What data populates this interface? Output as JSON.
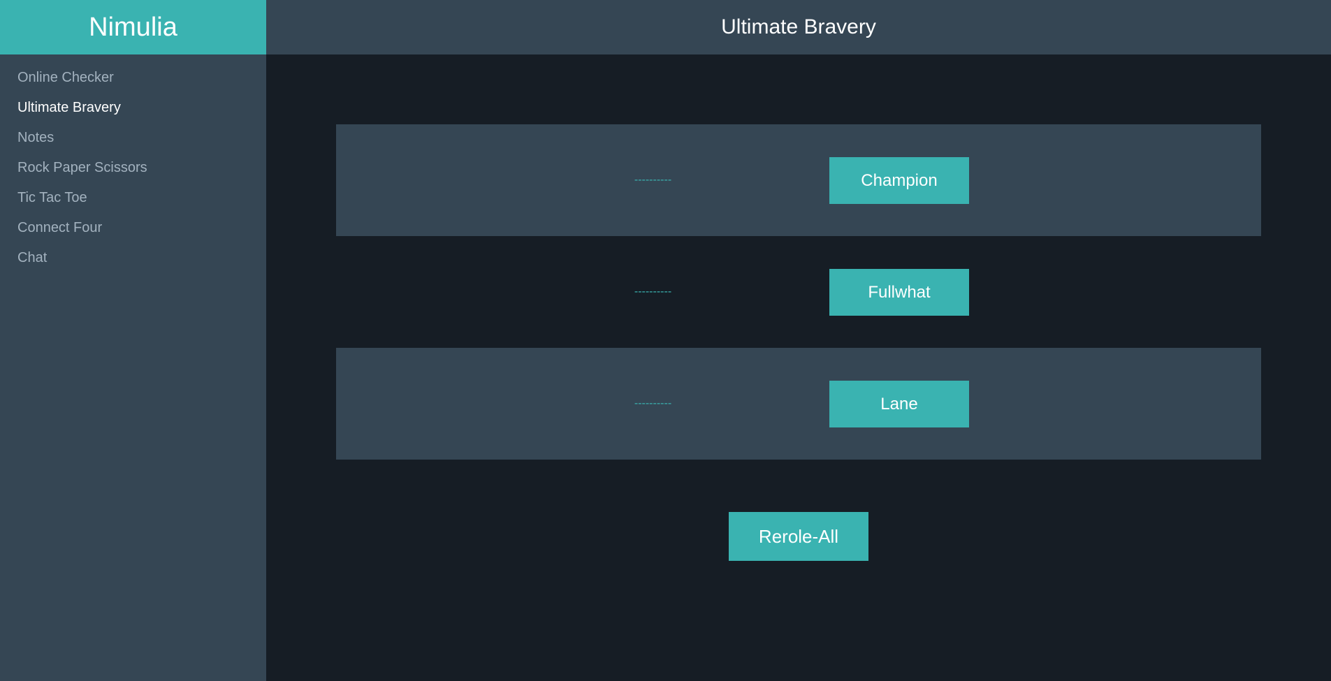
{
  "sidebar": {
    "brand": "Nimulia",
    "items": [
      {
        "label": "Online Checker"
      },
      {
        "label": "Ultimate Bravery"
      },
      {
        "label": "Notes"
      },
      {
        "label": "Rock Paper Scissors"
      },
      {
        "label": "Tic Tac Toe"
      },
      {
        "label": "Connect Four"
      },
      {
        "label": "Chat"
      }
    ],
    "active_index": 1
  },
  "header": {
    "title": "Ultimate Bravery"
  },
  "main": {
    "rows": [
      {
        "value": "----------",
        "button": "Champion"
      },
      {
        "value": "----------",
        "button": "Fullwhat"
      },
      {
        "value": "----------",
        "button": "Lane"
      }
    ],
    "reroll_button": "Rerole-All"
  },
  "colors": {
    "accent": "#3ab3b1",
    "panel": "#354654",
    "background": "#161d25",
    "nav_text": "#a3b2bf"
  }
}
